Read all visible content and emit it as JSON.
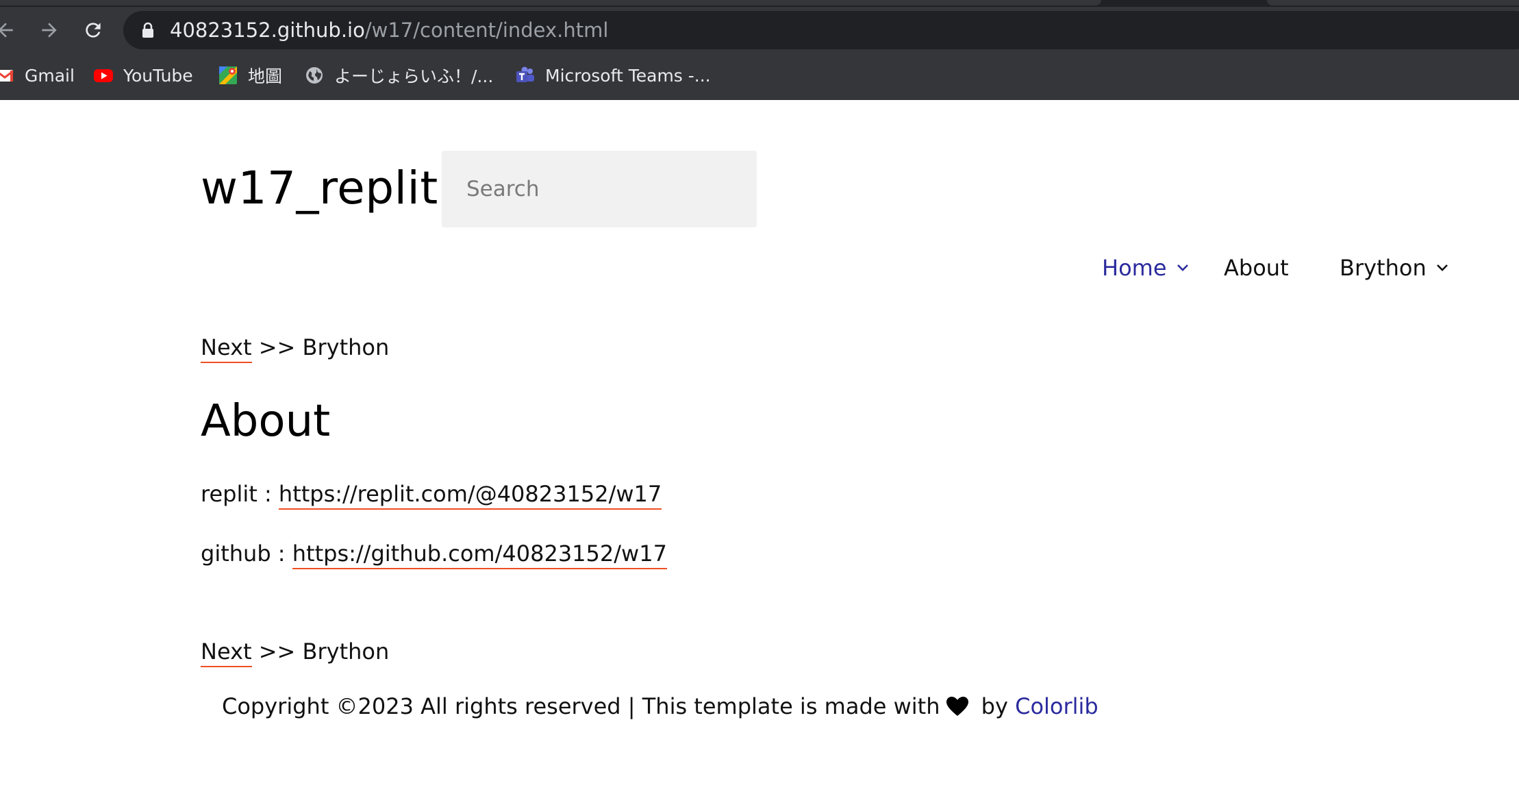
{
  "browser": {
    "url_host": "40823152.github.io",
    "url_path": "/w17/content/index.html",
    "bookmarks": [
      {
        "label": "Gmail",
        "icon": "gmail-icon"
      },
      {
        "label": "YouTube",
        "icon": "youtube-icon"
      },
      {
        "label": "地圖",
        "icon": "maps-icon"
      },
      {
        "label": "よーじょらいふ！/...",
        "icon": "globe-icon"
      },
      {
        "label": "Microsoft Teams -...",
        "icon": "teams-icon"
      }
    ]
  },
  "site": {
    "title": "w17_replit",
    "search_placeholder": "Search"
  },
  "nav": {
    "home": "Home",
    "about": "About",
    "brython": "Brython"
  },
  "breadcrumb": {
    "link": "Next",
    "rest": " >> Brython"
  },
  "content": {
    "heading": "About",
    "replit_label": "replit : ",
    "replit_url": "https://replit.com/@40823152/w17",
    "github_label": "github : ",
    "github_url": "https://github.com/40823152/w17"
  },
  "footer": {
    "text_before": "Copyright ©2023 All rights reserved | This template is made with",
    "text_by": " by ",
    "link": "Colorlib"
  },
  "colors": {
    "accent_link": "#2b2b9e",
    "underline": "#f04e23",
    "chrome_bg": "#35363a"
  }
}
